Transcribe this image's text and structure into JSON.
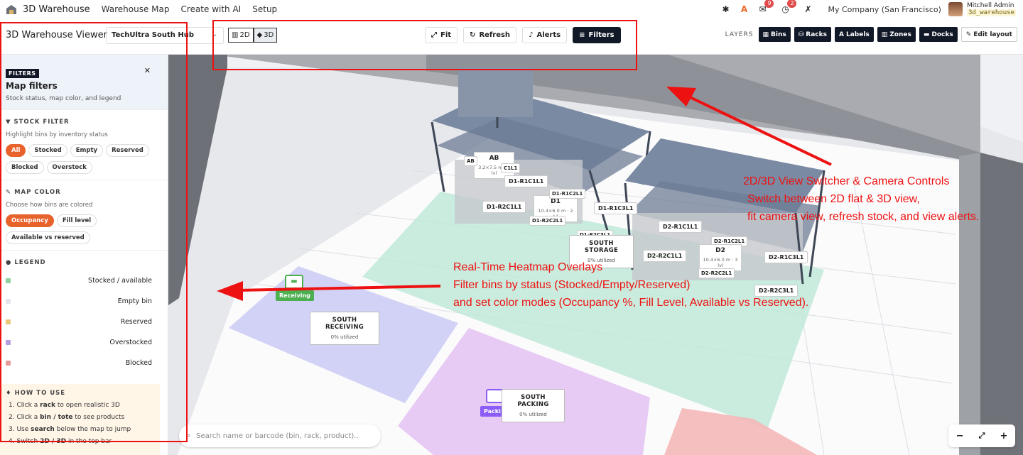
{
  "topnav": {
    "app_title": "3D Warehouse",
    "menu": [
      "Warehouse Map",
      "Create with AI",
      "Setup"
    ],
    "icons": [
      "bug-icon",
      "ai-icon",
      "chat-icon",
      "activity-icon",
      "tools-icon"
    ],
    "chat_badge": "9",
    "activity_badge": "2",
    "company": "My Company (San Francisco)",
    "user_name": "Mitchell Admin",
    "user_db": "3d_warehouse"
  },
  "toolbar": {
    "viewer_title": "3D Warehouse Viewer",
    "hub": "TechUltra South Hub",
    "view_2d": "2D",
    "view_3d": "3D",
    "fit": "Fit",
    "refresh": "Refresh",
    "alerts": "Alerts",
    "filters": "Filters",
    "layers_label": "LAYERS",
    "layers": [
      "Bins",
      "Racks",
      "Labels",
      "Zones",
      "Docks"
    ],
    "edit_layout": "Edit layout"
  },
  "sidebar": {
    "badge": "FILTERS",
    "title": "Map filters",
    "subtitle": "Stock status, map color, and legend",
    "stock_filter": {
      "title": "STOCK FILTER",
      "subtitle": "Highlight bins by inventory status",
      "chips": [
        "All",
        "Stocked",
        "Empty",
        "Reserved",
        "Blocked",
        "Overstock"
      ],
      "active": "All"
    },
    "map_color": {
      "title": "MAP COLOR",
      "subtitle": "Choose how bins are colored",
      "chips": [
        "Occupancy",
        "Fill level",
        "Available vs reserved"
      ],
      "active": "Occupancy"
    },
    "legend": {
      "title": "LEGEND",
      "items": [
        {
          "label": "Stocked / available",
          "color": "#8fd19e"
        },
        {
          "label": "Empty bin",
          "color": "#e3e6ea"
        },
        {
          "label": "Reserved",
          "color": "#e9c77b"
        },
        {
          "label": "Overstocked",
          "color": "#b49ee0"
        },
        {
          "label": "Blocked",
          "color": "#e59a9a"
        }
      ]
    },
    "howto": {
      "title": "HOW TO USE",
      "steps": [
        {
          "n": "1. Click a ",
          "b": "rack",
          "t": " to open realistic 3D"
        },
        {
          "n": "2. Click a ",
          "b": "bin / tote",
          "t": " to see products"
        },
        {
          "n": "3. Use ",
          "b": "search",
          "t": " below the map to jump"
        },
        {
          "n": "4. Switch ",
          "b": "2D / 3D",
          "t": " in the top bar"
        }
      ]
    }
  },
  "map": {
    "rack_ab": {
      "name": "AB",
      "dims": "3.2×7.5 m · 3 lvl",
      "ab_tag": "AB"
    },
    "rack_d1": {
      "name": "D1",
      "dims": "10.4×6.0 m · 2 lvl"
    },
    "rack_d2": {
      "name": "D2",
      "dims": "10.4×6.0 m · 3 lvl"
    },
    "bins": [
      "D1-R1C1L1",
      "D1-R2C1L1",
      "D1-R1C2L1",
      "D1-R2C2L1",
      "D1-R1C3L1",
      "D1-R2C3L1",
      "D2-R1C1L1",
      "D2-R1C2L1",
      "D2-R2C1L1",
      "D2-R2C2L1",
      "D2-R1C3L1",
      "D2-R2C3L1",
      "C1L1"
    ],
    "zones": [
      {
        "name": "SOUTH STORAGE",
        "util": "0% utilized"
      },
      {
        "name": "SOUTH RECEIVING",
        "util": "0% utilized"
      },
      {
        "name": "SOUTH PACKING",
        "util": "0% utilized"
      }
    ],
    "dock_receiving": "Receiving",
    "dock_packing": "Packi",
    "search_placeholder": "Search name or barcode (bin, rack, product)...",
    "zoom_out": "−",
    "zoom_fit": "⤢",
    "zoom_in": "+"
  },
  "annotations": {
    "view_switcher": [
      "2D/3D View Switcher & Camera Controls",
      "Switch between 2D flat & 3D view,",
      "fit camera view, refresh stock, and view alerts."
    ],
    "heatmap": [
      "Real-Time Heatmap Overlays",
      "Filter bins by status (Stocked/Empty/Reserved)",
      "and set color modes (Occupancy %, Fill Level, Available vs Reserved)."
    ]
  }
}
